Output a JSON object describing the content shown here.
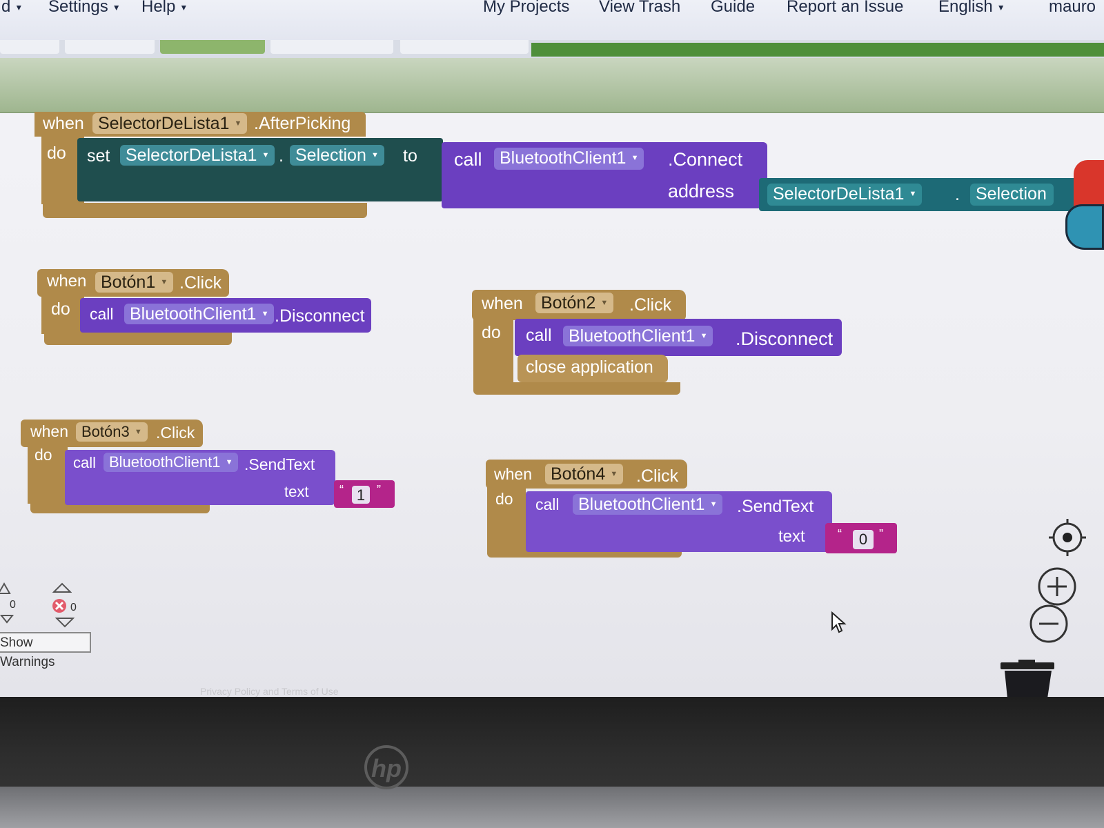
{
  "menu": {
    "items": [
      {
        "label": "d"
      },
      {
        "label": "Settings"
      },
      {
        "label": "Help"
      },
      {
        "label": "My Projects"
      },
      {
        "label": "View Trash"
      },
      {
        "label": "Guide"
      },
      {
        "label": "Report an Issue"
      },
      {
        "label": "English"
      },
      {
        "label": "mauro"
      }
    ]
  },
  "blocks": {
    "when": "when",
    "do": "do",
    "call": "call",
    "set": "set",
    "to": "to",
    "b1": {
      "component": "SelectorDeLista1",
      "event": ".AfterPicking",
      "set_component": "SelectorDeLista1",
      "set_property": "Selection",
      "call_component": "BluetoothClient1",
      "call_method": ".Connect",
      "arg_label": "address",
      "get_component": "SelectorDeLista1",
      "get_property": "Selection"
    },
    "b2": {
      "component": "Botón1",
      "event": ".Click",
      "call_component": "BluetoothClient1",
      "call_method": ".Disconnect"
    },
    "b3": {
      "component": "Botón2",
      "event": ".Click",
      "call_component": "BluetoothClient1",
      "call_method": ".Disconnect",
      "extra": "close application"
    },
    "b4": {
      "component": "Botón3",
      "event": ".Click",
      "call_component": "BluetoothClient1",
      "call_method": ".SendText",
      "arg_label": "text",
      "text_value": "1"
    },
    "b5": {
      "component": "Botón4",
      "event": ".Click",
      "call_component": "BluetoothClient1",
      "call_method": ".SendText",
      "arg_label": "text",
      "text_value": "0"
    },
    "dot": "."
  },
  "warnings": {
    "warning_count": "0",
    "error_count": "0",
    "button_label": "Show Warnings"
  },
  "footer": {
    "text": "Privacy Policy and Terms of Use"
  },
  "icons": {
    "recenter": "target-icon",
    "zoom_in": "plus-circle-icon",
    "zoom_out": "minus-circle-icon",
    "trash": "trash-icon",
    "cursor": "mouse-pointer-icon",
    "logo": "hp-logo"
  }
}
